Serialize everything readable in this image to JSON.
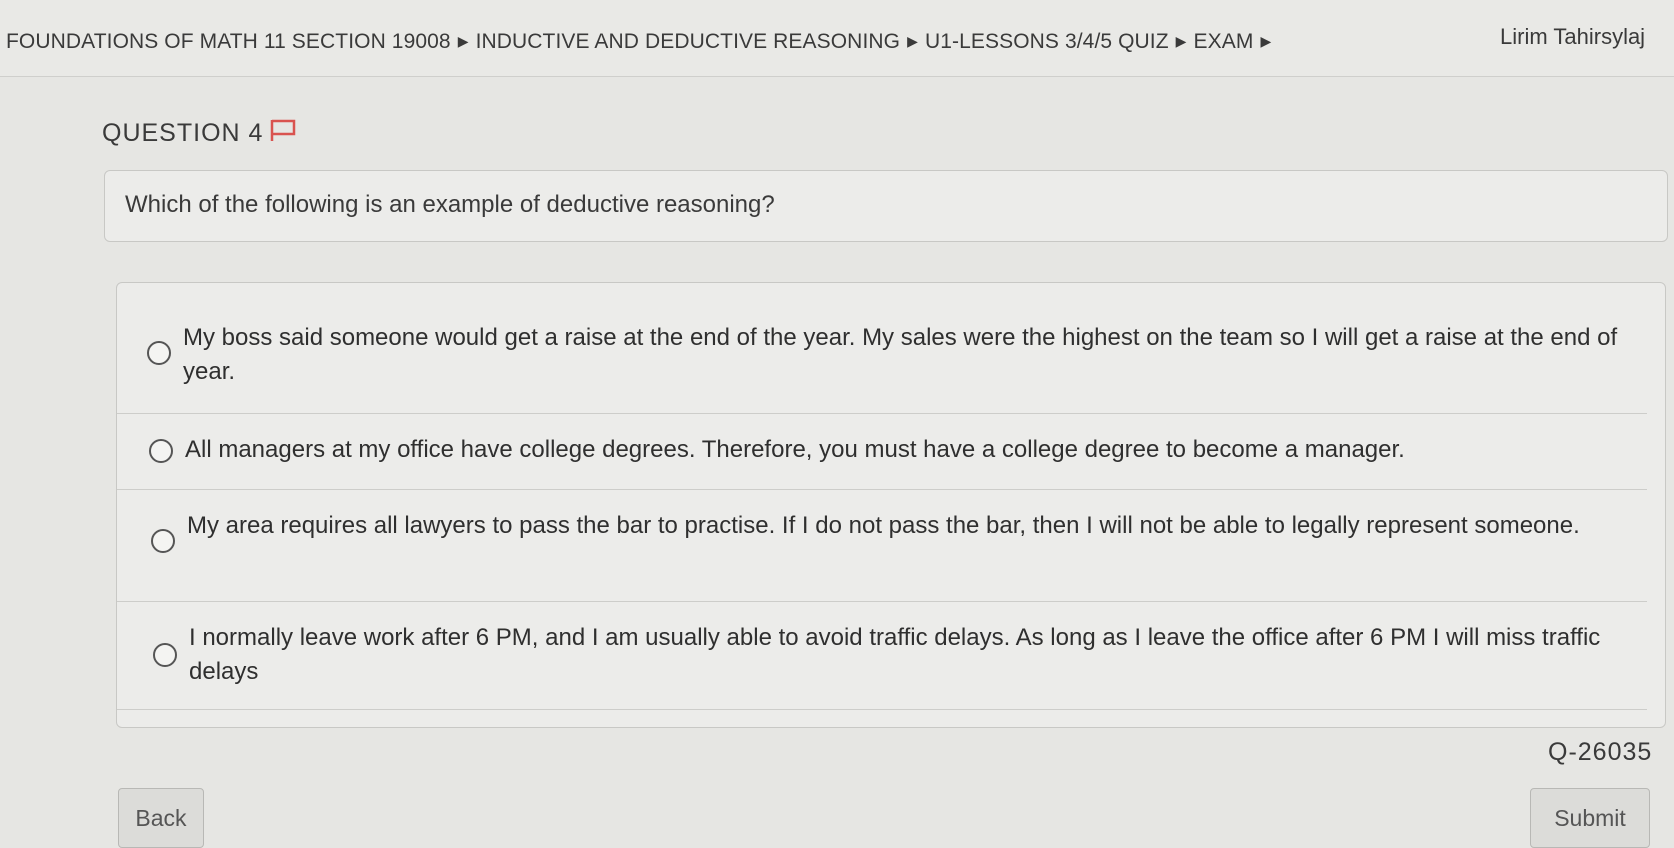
{
  "header": {
    "breadcrumb": [
      "FOUNDATIONS OF MATH 11 SECTION 19008",
      "INDUCTIVE AND DEDUCTIVE REASONING",
      "U1-LESSONS 3/4/5 QUIZ",
      "EXAM"
    ],
    "separator": "▶",
    "user_name": "Lirim Tahirsylaj"
  },
  "question": {
    "title": "QUESTION 4",
    "prompt": "Which of the following is an example of deductive reasoning?",
    "options": [
      "My boss said someone would get a raise at the end of the year. My sales were the highest on the team so I will get a raise at the end of year.",
      "All managers at my office have college degrees. Therefore, you must have a college degree to become a manager.",
      "My area requires all lawyers to pass the bar to practise. If I do not pass the bar, then I will not be able to legally represent someone.",
      "I normally leave work after 6 PM, and I am usually able to avoid traffic delays. As long as I leave the office after 6 PM I will miss traffic delays"
    ],
    "id": "Q-26035"
  },
  "buttons": {
    "back": "Back",
    "submit": "Submit"
  },
  "colors": {
    "flag": "#d9534f"
  },
  "icons": {
    "flag": "flag-icon",
    "separator": "triangle-right-icon",
    "radio": "radio-empty-icon"
  }
}
